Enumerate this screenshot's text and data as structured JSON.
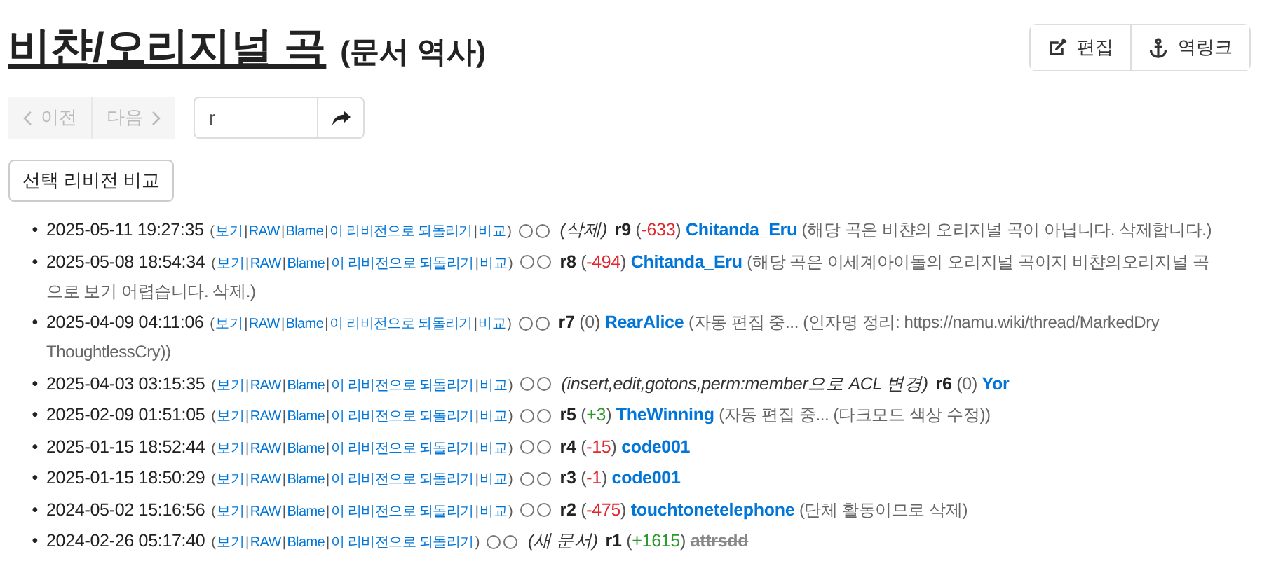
{
  "title": {
    "name": "비챤/오리지널 곡",
    "suffix": "(문서 역사)"
  },
  "actions": [
    {
      "label": "편집",
      "kind": "edit"
    },
    {
      "label": "역링크",
      "kind": "backlinks"
    }
  ],
  "nav": {
    "prev": {
      "label": "이전",
      "disabled": true
    },
    "next": {
      "label": "다음",
      "disabled": true
    },
    "jump_value": "r"
  },
  "compare_button": "선택 리비전 비교",
  "revisions": [
    {
      "bullet": "•",
      "time": "2025-05-11 19:27:35",
      "links": [
        "(",
        "보기",
        "|",
        "RAW",
        "|",
        "Blame",
        "|",
        "이 리비전으로 되돌리기",
        "|",
        "비교",
        ")"
      ],
      "radios": [
        {
          "selected": false
        },
        {
          "selected": false
        }
      ],
      "note": "(삭제)",
      "rev": "r9",
      "change": {
        "text": "(-633)",
        "color": "#e0282e"
      },
      "user": "Chitanda_Eru",
      "deleted": false,
      "comment": [
        "(해당 곡은 비챤의 오리지널 곡이 아닙니다. 삭제합니다.)"
      ]
    },
    {
      "bullet": "•",
      "time": "2025-05-08 18:54:34",
      "links": [
        "(",
        "보기",
        "|",
        "RAW",
        "|",
        "Blame",
        "|",
        "이 리비전으로 되돌리기",
        "|",
        "비교",
        ")"
      ],
      "radios": [
        {
          "selected": false
        },
        {
          "selected": false
        }
      ],
      "rev": "r8",
      "change": {
        "text": "(-494)",
        "color": "#e0282e"
      },
      "user": "Chitanda_Eru",
      "deleted": false,
      "comment": [
        "(해당 곡은 이세계아이돌의 오리지널 곡이지 비챤의오리지널 곡",
        "으로 보기 어렵습니다. 삭제.)"
      ]
    },
    {
      "bullet": "•",
      "time": "2025-04-09 04:11:06",
      "links": [
        "(",
        "보기",
        "|",
        "RAW",
        "|",
        "Blame",
        "|",
        "이 리비전으로 되돌리기",
        "|",
        "비교",
        ")"
      ],
      "radios": [
        {
          "selected": false
        },
        {
          "selected": false
        }
      ],
      "rev": "r7",
      "change": {
        "text": "(0)",
        "color": "#666666"
      },
      "user": "RearAlice",
      "deleted": false,
      "comment": [
        "(자동 편집 중... (인자명 정리: https://namu.wiki/thread/MarkedDry",
        "ThoughtlessCry))"
      ]
    },
    {
      "bullet": "•",
      "time": "2025-04-03 03:15:35",
      "links": [
        "(",
        "보기",
        "|",
        "RAW",
        "|",
        "Blame",
        "|",
        "이 리비전으로 되돌리기",
        "|",
        "비교",
        ")"
      ],
      "radios": [
        {
          "selected": false
        },
        {
          "selected": false
        }
      ],
      "note": "(insert,edit,gotons,perm:member으로 ACL 변경)",
      "rev": "r6",
      "change": {
        "text": "(0)",
        "color": "#666666"
      },
      "user": "Yor",
      "deleted": false
    },
    {
      "bullet": "•",
      "time": "2025-02-09 01:51:05",
      "links": [
        "(",
        "보기",
        "|",
        "RAW",
        "|",
        "Blame",
        "|",
        "이 리비전으로 되돌리기",
        "|",
        "비교",
        ")"
      ],
      "radios": [
        {
          "selected": false
        },
        {
          "selected": false
        }
      ],
      "rev": "r5",
      "change": {
        "text": "(+3)",
        "color": "#2c9a2c"
      },
      "user": "TheWinning",
      "deleted": false,
      "comment": [
        "(자동 편집 중... (다크모드 색상 수정))"
      ]
    },
    {
      "bullet": "•",
      "time": "2025-01-15 18:52:44",
      "links": [
        "(",
        "보기",
        "|",
        "RAW",
        "|",
        "Blame",
        "|",
        "이 리비전으로 되돌리기",
        "|",
        "비교",
        ")"
      ],
      "radios": [
        {
          "selected": false
        },
        {
          "selected": false
        }
      ],
      "rev": "r4",
      "change": {
        "text": "(-15)",
        "color": "#e0282e"
      },
      "user": "code001",
      "deleted": false
    },
    {
      "bullet": "•",
      "time": "2025-01-15 18:50:29",
      "links": [
        "(",
        "보기",
        "|",
        "RAW",
        "|",
        "Blame",
        "|",
        "이 리비전으로 되돌리기",
        "|",
        "비교",
        ")"
      ],
      "radios": [
        {
          "selected": false
        },
        {
          "selected": false
        }
      ],
      "rev": "r3",
      "change": {
        "text": "(-1)",
        "color": "#e0282e"
      },
      "user": "code001",
      "deleted": false
    },
    {
      "bullet": "•",
      "time": "2024-05-02 15:16:56",
      "links": [
        "(",
        "보기",
        "|",
        "RAW",
        "|",
        "Blame",
        "|",
        "이 리비전으로 되돌리기",
        "|",
        "비교",
        ")"
      ],
      "radios": [
        {
          "selected": false
        },
        {
          "selected": false
        }
      ],
      "rev": "r2",
      "change": {
        "text": "(-475)",
        "color": "#e0282e"
      },
      "user": "touchtonetelephone",
      "deleted": false,
      "comment": [
        "(단체 활동이므로 삭제)"
      ]
    },
    {
      "bullet": "•",
      "time": "2024-02-26 05:17:40",
      "links": [
        "(",
        "보기",
        "|",
        "RAW",
        "|",
        "Blame",
        "|",
        "이 리비전으로 되돌리기",
        ")"
      ],
      "radios": [
        {
          "selected": false
        },
        {
          "selected": false
        }
      ],
      "note": "(새 문서)",
      "rev": "r1",
      "change": {
        "text": "(+1615)",
        "color": "#2c9a2c"
      },
      "user": "attrsdd",
      "deleted": true
    }
  ]
}
